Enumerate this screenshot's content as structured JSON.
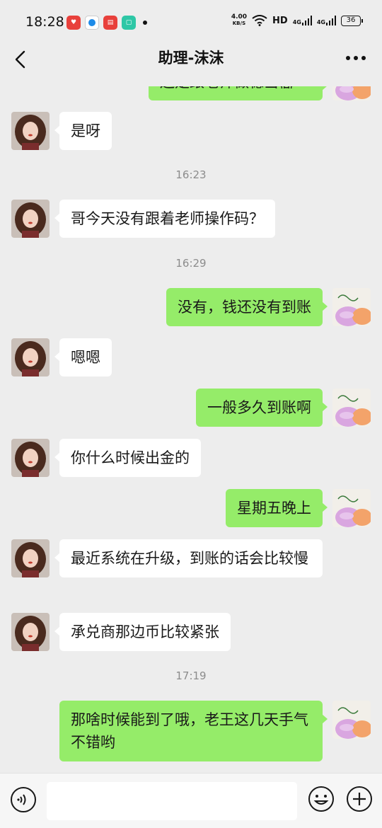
{
  "status_bar": {
    "time": "18:28",
    "net_speed": "4.00",
    "net_unit": "KB/S",
    "hd_label": "HD",
    "signal_1": "4G",
    "signal_2": "4G",
    "battery": "36",
    "app_icons": [
      "heart-app-icon",
      "browser-app-icon",
      "news-app-icon",
      "phone-manager-icon"
    ]
  },
  "header": {
    "title": "助理-沫沫"
  },
  "messages": [
    {
      "type": "text",
      "side": "out",
      "text": "还是跟老师做稳当😱"
    },
    {
      "type": "text",
      "side": "in",
      "text": "是呀"
    },
    {
      "type": "time",
      "text": "16:23"
    },
    {
      "type": "text",
      "side": "in",
      "text": "哥今天没有跟着老师操作码？"
    },
    {
      "type": "time",
      "text": "16:29"
    },
    {
      "type": "text",
      "side": "out",
      "text": "没有，钱还没有到账"
    },
    {
      "type": "text",
      "side": "in",
      "text": "嗯嗯"
    },
    {
      "type": "text",
      "side": "out",
      "text": "一般多久到账啊"
    },
    {
      "type": "text",
      "side": "in",
      "text": "你什么时候出金的"
    },
    {
      "type": "text",
      "side": "out",
      "text": "星期五晚上"
    },
    {
      "type": "text",
      "side": "in",
      "text": "最近系统在升级，到账的话会比较慢"
    },
    {
      "type": "text",
      "side": "in",
      "text": "承兑商那边币比较紧张"
    },
    {
      "type": "time",
      "text": "17:19"
    },
    {
      "type": "text",
      "side": "out",
      "text": "那啥时候能到了哦，老王这几天手气不错哟"
    }
  ],
  "input_bar": {
    "placeholder": "",
    "voice_icon": "voice-icon",
    "emoji_icon": "emoji-icon",
    "plus_icon": "plus-icon"
  },
  "colors": {
    "background": "#ededed",
    "bubble_out": "#95ec69",
    "bubble_in": "#ffffff",
    "timestamp": "#8c8c8c"
  }
}
